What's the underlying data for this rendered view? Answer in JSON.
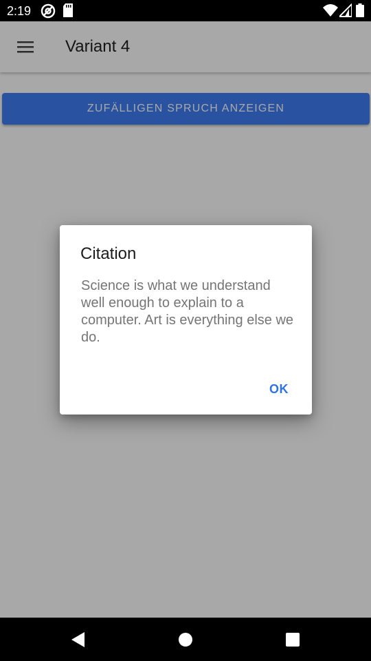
{
  "status_bar": {
    "time": "2:19",
    "icons": [
      "at-sign-icon",
      "sd-card-icon",
      "wifi-icon",
      "signal-icon",
      "battery-icon"
    ]
  },
  "toolbar": {
    "menu_icon": "hamburger-menu-icon",
    "title": "Variant 4"
  },
  "main": {
    "button_label": "ZUFÄLLIGEN SPRUCH ANZEIGEN"
  },
  "dialog": {
    "title": "Citation",
    "message": "Science is what we understand well enough to explain to a computer. Art is everything else we do.",
    "ok_label": "OK"
  },
  "nav_bar": {
    "icons": [
      "back-icon",
      "home-icon",
      "recents-icon"
    ]
  },
  "colors": {
    "accent": "#3f7ef5",
    "dialog_button": "#2f72e6",
    "scrim": "rgba(0,0,0,0.34)"
  }
}
